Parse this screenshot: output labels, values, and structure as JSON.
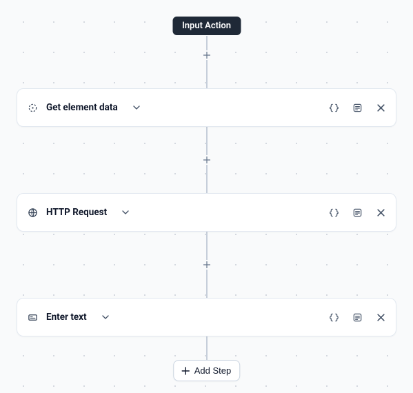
{
  "header": {
    "title": "Input Action"
  },
  "steps": [
    {
      "icon": "crosshair-icon",
      "title": "Get element data"
    },
    {
      "icon": "globe-icon",
      "title": "HTTP Request"
    },
    {
      "icon": "form-icon",
      "title": "Enter text"
    }
  ],
  "addStep": {
    "label": "Add Step"
  }
}
